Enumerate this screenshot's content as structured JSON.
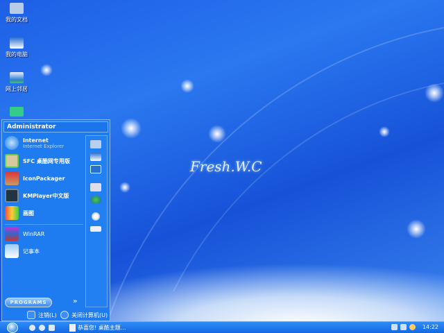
{
  "desktop": {
    "icons": [
      {
        "label": "我的文档",
        "icon": "folder-icon"
      },
      {
        "label": "我的电脑",
        "icon": "computer-icon"
      },
      {
        "label": "网上邻居",
        "icon": "network-icon"
      },
      {
        "label": "",
        "icon": "recycle-icon"
      }
    ],
    "logo": "Fresh.W.C"
  },
  "start_menu": {
    "user": "Administrator",
    "items": [
      {
        "title": "Internet",
        "subtitle": "Internet Explorer",
        "icon": "ie-icon"
      },
      {
        "title": "SFC 桌酷网专用版",
        "icon": "sfc-icon"
      },
      {
        "title": "IconPackager",
        "icon": "iconpackager-icon"
      },
      {
        "title": "KMPlayer中文版",
        "icon": "kmplayer-icon"
      },
      {
        "title": "画图",
        "icon": "paint-icon"
      }
    ],
    "recent": [
      {
        "title": "WinRAR",
        "icon": "winrar-icon"
      },
      {
        "title": "记事本",
        "icon": "notepad-icon"
      }
    ],
    "programs_label": "PROGRAMS",
    "arrows": "»",
    "logoff": "注销(L)",
    "shutdown": "关闭计算机(U)"
  },
  "taskbar": {
    "task": "恭喜您! 桌酷主题...",
    "clock": "14:22"
  },
  "colors": {
    "accent": "#1f7cf0"
  }
}
